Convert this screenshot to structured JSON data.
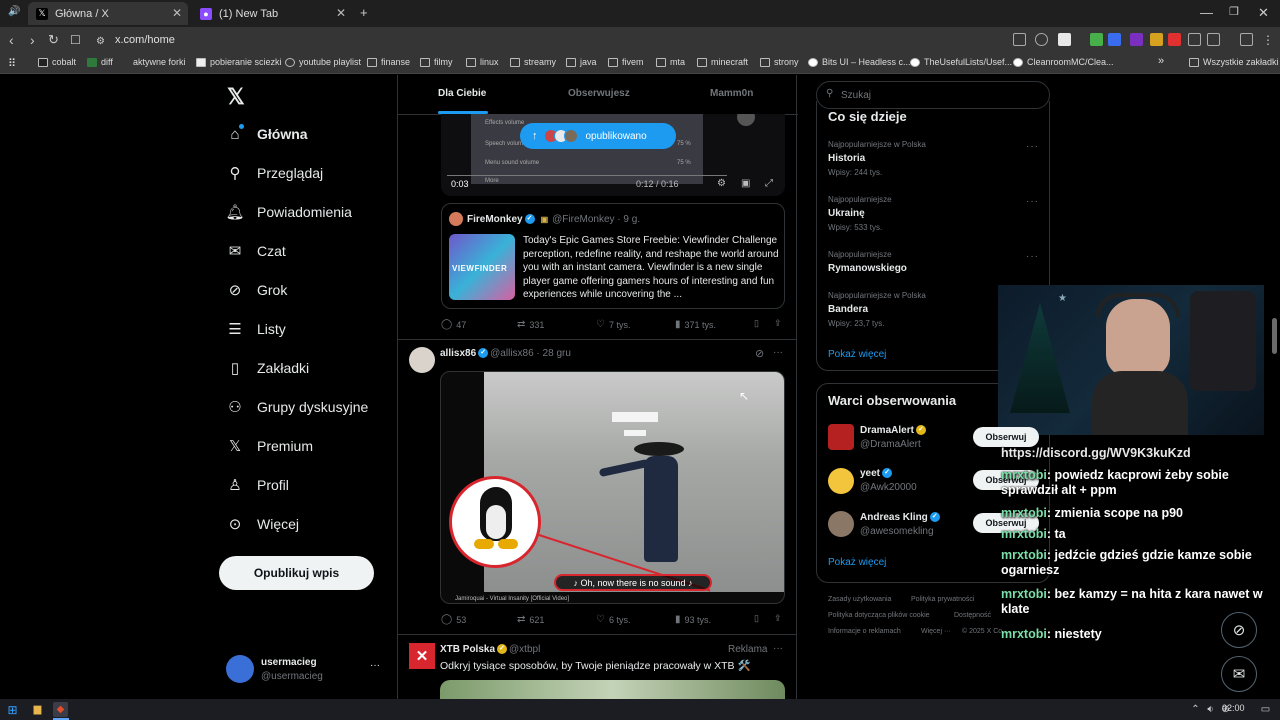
{
  "browser": {
    "tabs": [
      {
        "title": "Główna / X",
        "favicon": "x-logo-icon"
      },
      {
        "title": "(1) New Tab",
        "favicon": "new-tab-icon"
      }
    ],
    "url": "x.com/home",
    "bookmarks": [
      "cobalt",
      "diff",
      "aktywne forki",
      "pobieranie sciezki",
      "youtube playlist",
      "finanse",
      "filmy",
      "linux",
      "streamy",
      "java",
      "fivem",
      "mta",
      "minecraft",
      "strony",
      "Bits UI – Headless c...",
      "TheUsefulLists/Usef...",
      "CleanroomMC/Clea..."
    ],
    "all_bookmarks": "Wszystkie zakładki"
  },
  "nav": {
    "items": [
      {
        "label": "Główna",
        "icon": "home-icon"
      },
      {
        "label": "Przeglądaj",
        "icon": "search-icon"
      },
      {
        "label": "Powiadomienia",
        "icon": "bell-icon"
      },
      {
        "label": "Czat",
        "icon": "mail-icon"
      },
      {
        "label": "Grok",
        "icon": "grok-icon"
      },
      {
        "label": "Listy",
        "icon": "list-icon"
      },
      {
        "label": "Zakładki",
        "icon": "bookmark-icon"
      },
      {
        "label": "Grupy dyskusyjne",
        "icon": "communities-icon"
      },
      {
        "label": "Premium",
        "icon": "x-logo-icon"
      },
      {
        "label": "Profil",
        "icon": "person-icon"
      },
      {
        "label": "Więcej",
        "icon": "more-circle-icon"
      }
    ],
    "post_button": "Opublikuj wpis",
    "account": {
      "name": "usermacieg",
      "handle": "@usermacieg"
    }
  },
  "feed": {
    "tabs": [
      "Dla Ciebie",
      "Obserwujesz",
      "Mamm0n"
    ],
    "new_posts_pill": "opublikowano",
    "video1": {
      "time_left": "0:03",
      "time_total": "0:12 / 0:16",
      "setting_rows": [
        "Effects volume",
        "Speech volume",
        "Menu sound volume",
        "More"
      ],
      "setting_values": [
        "75 %",
        "75 %",
        "75 %"
      ]
    },
    "quote": {
      "name": "FireMonkey",
      "handle": "@FireMonkey · 9 g.",
      "text": "Today's Epic Games Store Freebie: Viewfinder Challenge perception, redefine reality, and reshape the world around you with an instant camera. Viewfinder is a new single player game offering gamers hours of interesting and fun experiences while uncovering the ..."
    },
    "post1_stats": {
      "replies": "47",
      "reposts": "331",
      "likes": "7 tys.",
      "views": "371 tys."
    },
    "post2": {
      "name": "allisx86",
      "handle": "@allisx86 · 28 gru",
      "caption": "♪ Oh, now there is no sound ♪",
      "video_title": "Jamiroquai - Virtual Insanity [Official Video]",
      "stats": {
        "replies": "53",
        "reposts": "621",
        "likes": "6 tys.",
        "views": "93 tys."
      }
    },
    "post3": {
      "name": "XTB Polska",
      "handle": "@xtbpl",
      "badge": "Reklama",
      "text": "Odkryj tysiące sposobów, by Twoje pieniądze pracowały w XTB 🛠️"
    }
  },
  "sidebar": {
    "search_placeholder": "Szukaj",
    "trends_title": "Co się dzieje",
    "trends": [
      {
        "meta": "Najpopularniejsze w Polska",
        "name": "Historia",
        "posts": "Wpisy: 244 tys."
      },
      {
        "meta": "Najpopularniejsze",
        "name": "Ukrainę",
        "posts": "Wpisy: 533 tys."
      },
      {
        "meta": "Najpopularniejsze",
        "name": "Rymanowskiego",
        "posts": ""
      },
      {
        "meta": "Najpopularniejsze w Polska",
        "name": "Bandera",
        "posts": "Wpisy: 23,7 tys."
      }
    ],
    "show_more": "Pokaż więcej",
    "who_title": "Warci obserwowania",
    "who": [
      {
        "name": "DramaAlert",
        "handle": "@DramaAlert"
      },
      {
        "name": "yeet",
        "handle": "@Awk20000"
      },
      {
        "name": "Andreas Kling",
        "handle": "@awesomekling"
      }
    ],
    "follow_label": "Obserwuj",
    "footer": [
      "Zasady użytkowania",
      "Polityka prywatności",
      "Polityka dotycząca plików cookie",
      "Dostępność",
      "Informacje o reklamach",
      "Więcej ···",
      "© 2025 X Co"
    ]
  },
  "chat": {
    "lines": [
      {
        "user": "",
        "text": "https://discord.gg/WV9K3kuKzd"
      },
      {
        "user": "mrxtobi",
        "text": ": powiedz kacprowi żeby sobie sprawdził alt + ppm"
      },
      {
        "user": "mrxtobi",
        "text": ": zmienia scope na p90"
      },
      {
        "user": "mrxtobi",
        "text": ": ta"
      },
      {
        "user": "mrxtobi",
        "text": ": jedźcie gdzieś gdzie kamze sobie ogarniesz"
      },
      {
        "user": "mrxtobi",
        "text": ": bez kamzy = na hita z kara nawet w klate"
      },
      {
        "user": "mrxtobi",
        "text": ": niestety"
      }
    ]
  },
  "taskbar": {
    "time": "02:00"
  },
  "colors": {
    "accent": "#1d9bf0",
    "chat_user": "#7adfa8",
    "background": "#000000"
  }
}
